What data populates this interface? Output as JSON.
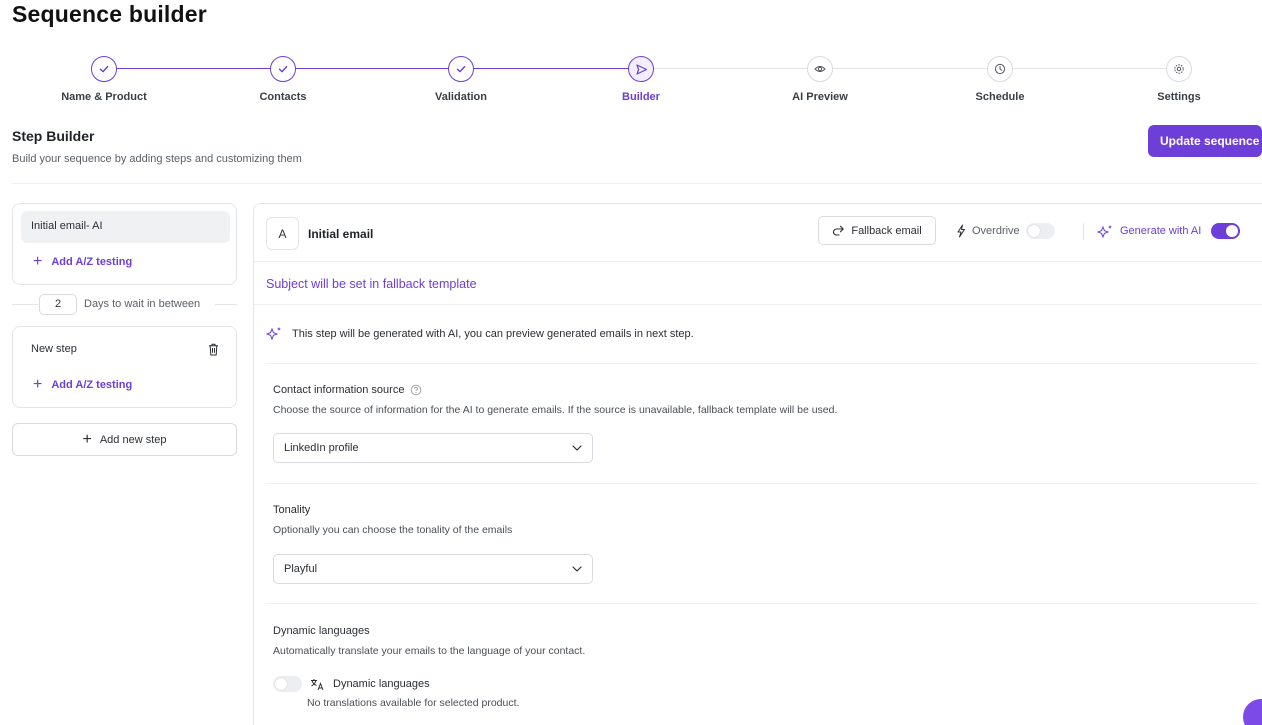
{
  "page": {
    "title": "Sequence builder"
  },
  "stepper": {
    "steps": [
      {
        "label": "Name & Product",
        "state": "done",
        "icon": "check-icon"
      },
      {
        "label": "Contacts",
        "state": "done",
        "icon": "check-icon"
      },
      {
        "label": "Validation",
        "state": "done",
        "icon": "check-icon"
      },
      {
        "label": "Builder",
        "state": "current",
        "icon": "send-icon"
      },
      {
        "label": "AI Preview",
        "state": "todo",
        "icon": "eye-icon"
      },
      {
        "label": "Schedule",
        "state": "todo",
        "icon": "clock-icon"
      },
      {
        "label": "Settings",
        "state": "todo",
        "icon": "gear-icon"
      }
    ]
  },
  "header": {
    "title": "Step Builder",
    "subtitle": "Build your sequence by adding steps and customizing them",
    "update_button": "Update sequence"
  },
  "sidebar": {
    "steps": [
      {
        "label": "Initial email- AI",
        "add_ab": "Add A/Z testing"
      },
      {
        "label": "New step",
        "add_ab": "Add A/Z testing"
      }
    ],
    "wait_days": "2",
    "wait_label": "Days to wait in between",
    "add_step": "Add new step"
  },
  "editor": {
    "badge": "A",
    "title": "Initial email",
    "fallback_button": "Fallback email",
    "overdrive_label": "Overdrive",
    "overdrive_on": false,
    "generate_label": "Generate with AI",
    "generate_on": true,
    "subject": "Subject will be set in fallback template",
    "ai_note": "This step will be generated with AI, you can preview generated emails in next step.",
    "contact_source": {
      "label": "Contact information source",
      "description": "Choose the source of information for the AI to generate emails. If the source is unavailable, fallback template will be used.",
      "value": "LinkedIn profile"
    },
    "tonality": {
      "label": "Tonality",
      "description": "Optionally you can choose the tonality of the emails",
      "value": "Playful"
    },
    "dynamic_languages": {
      "label": "Dynamic languages",
      "description": "Automatically translate your emails to the language of your contact.",
      "toggle_label": "Dynamic languages",
      "toggle_on": false,
      "note": "No translations available for selected product."
    }
  },
  "colors": {
    "accent": "#6d3ed8",
    "border": "#e3e5e8"
  }
}
